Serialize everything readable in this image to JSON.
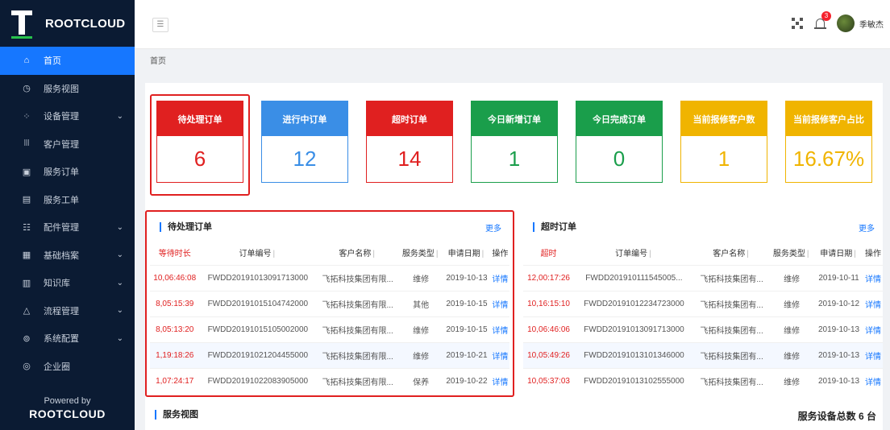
{
  "app": {
    "logo_text": "ROOTCLOUD"
  },
  "sidebar": {
    "items": [
      {
        "label": "首页",
        "icon": "home-icon",
        "glyph": "⌂",
        "active": true,
        "arrow": ""
      },
      {
        "label": "服务视图",
        "icon": "clock-icon",
        "glyph": "◷",
        "active": false,
        "arrow": ""
      },
      {
        "label": "设备管理",
        "icon": "grid-icon",
        "glyph": "⁘",
        "active": false,
        "arrow": "⌄"
      },
      {
        "label": "客户管理",
        "icon": "users-icon",
        "glyph": "ꔖ",
        "active": false,
        "arrow": ""
      },
      {
        "label": "服务订单",
        "icon": "order-icon",
        "glyph": "▣",
        "active": false,
        "arrow": ""
      },
      {
        "label": "服务工单",
        "icon": "ticket-icon",
        "glyph": "▤",
        "active": false,
        "arrow": ""
      },
      {
        "label": "配件管理",
        "icon": "parts-icon",
        "glyph": "☷",
        "active": false,
        "arrow": "⌄"
      },
      {
        "label": "基础档案",
        "icon": "archive-icon",
        "glyph": "▦",
        "active": false,
        "arrow": "⌄"
      },
      {
        "label": "知识库",
        "icon": "book-icon",
        "glyph": "▥",
        "active": false,
        "arrow": "⌄"
      },
      {
        "label": "流程管理",
        "icon": "flow-icon",
        "glyph": "△",
        "active": false,
        "arrow": "⌄"
      },
      {
        "label": "系统配置",
        "icon": "settings-icon",
        "glyph": "⊚",
        "active": false,
        "arrow": "⌄"
      },
      {
        "label": "企业圈",
        "icon": "circle-icon",
        "glyph": "◎",
        "active": false,
        "arrow": ""
      }
    ],
    "powered_by": "Powered by",
    "powered_brand": "ROOTCLOUD"
  },
  "header": {
    "menu_toggle": "☰",
    "notification_count": "3",
    "username": "季敏杰"
  },
  "breadcrumb": "首页",
  "cards": [
    {
      "label": "待处理订单",
      "value": "6",
      "color": "#e02020"
    },
    {
      "label": "进行中订单",
      "value": "12",
      "color": "#3a8ee6"
    },
    {
      "label": "超时订单",
      "value": "14",
      "color": "#e02020"
    },
    {
      "label": "今日新增订单",
      "value": "1",
      "color": "#1a9e4b"
    },
    {
      "label": "今日完成订单",
      "value": "0",
      "color": "#1a9e4b"
    },
    {
      "label": "当前报修客户数",
      "value": "1",
      "color": "#f0b400"
    },
    {
      "label": "当前报修客户占比",
      "value": "16.67%",
      "color": "#f0b400"
    }
  ],
  "pending_table": {
    "title": "待处理订单",
    "more": "更多",
    "headers": [
      "等待时长",
      "订单编号",
      "客户名称",
      "服务类型",
      "申请日期",
      "操作"
    ],
    "rows": [
      [
        "10,06:46:08",
        "FWDD20191013091713000",
        "飞拓科技集团有限...",
        "维修",
        "2019-10-13",
        "详情"
      ],
      [
        "8,05:15:39",
        "FWDD20191015104742000",
        "飞拓科技集团有限...",
        "其他",
        "2019-10-15",
        "详情"
      ],
      [
        "8,05:13:20",
        "FWDD20191015105002000",
        "飞拓科技集团有限...",
        "维修",
        "2019-10-15",
        "详情"
      ],
      [
        "1,19:18:26",
        "FWDD20191021204455000",
        "飞拓科技集团有限...",
        "维修",
        "2019-10-21",
        "详情"
      ],
      [
        "1,07:24:17",
        "FWDD20191022083905000",
        "飞拓科技集团有限...",
        "保养",
        "2019-10-22",
        "详情"
      ]
    ]
  },
  "timeout_table": {
    "title": "超时订单",
    "more": "更多",
    "headers": [
      "超时",
      "订单编号",
      "客户名称",
      "服务类型",
      "申请日期",
      "操作"
    ],
    "rows": [
      [
        "12,00:17:26",
        "FWDD201910111545005...",
        "飞拓科技集团有...",
        "维修",
        "2019-10-11",
        "详情"
      ],
      [
        "10,16:15:10",
        "FWDD20191012234723000",
        "飞拓科技集团有...",
        "维修",
        "2019-10-12",
        "详情"
      ],
      [
        "10,06:46:06",
        "FWDD20191013091713000",
        "飞拓科技集团有...",
        "维修",
        "2019-10-13",
        "详情"
      ],
      [
        "10,05:49:26",
        "FWDD20191013101346000",
        "飞拓科技集团有...",
        "维修",
        "2019-10-13",
        "详情"
      ],
      [
        "10,05:37:03",
        "FWDD20191013102555000",
        "飞拓科技集团有...",
        "维修",
        "2019-10-13",
        "详情"
      ]
    ]
  },
  "service_view": {
    "title": "服务视图",
    "total": "服务设备总数 6 台"
  }
}
